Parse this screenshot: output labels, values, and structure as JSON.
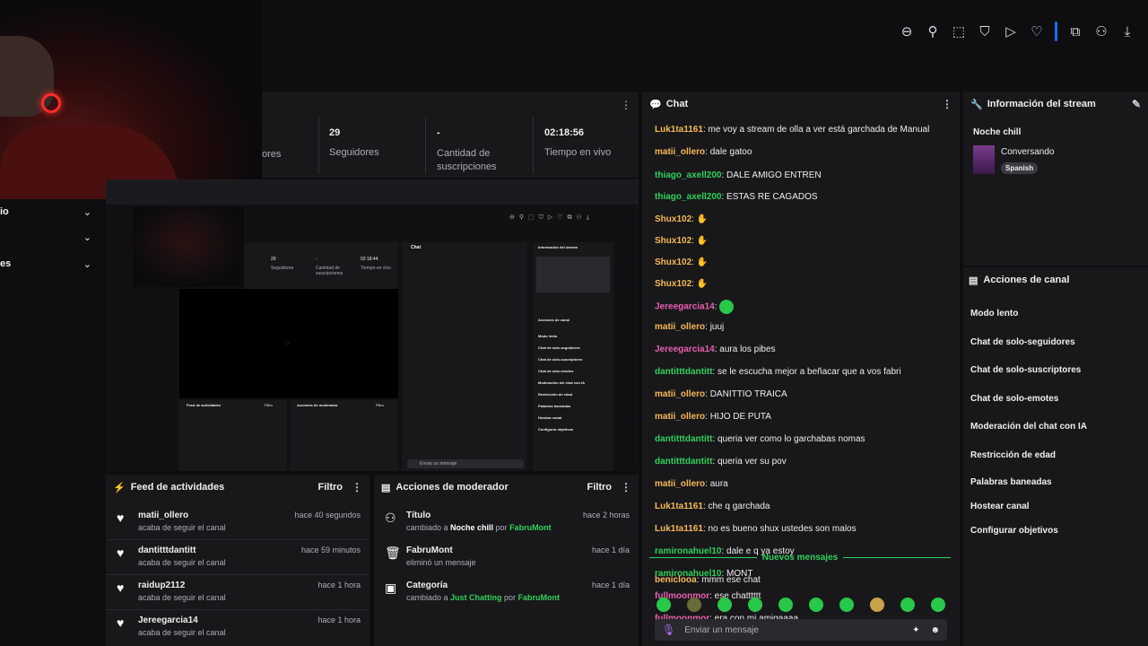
{
  "toolbar": {
    "icons": [
      "zoom-out-icon",
      "pin-icon",
      "crop-icon",
      "shield-icon",
      "send-icon",
      "heart-icon",
      "extension-icon",
      "profile-icon",
      "download-icon"
    ]
  },
  "stats": [
    {
      "value": "",
      "label": "ores"
    },
    {
      "value": "29",
      "label": "Seguidores"
    },
    {
      "value": "-",
      "label": "Cantidad de suscripciones"
    },
    {
      "value": "02:18:56",
      "label": "Tiempo en vivo"
    }
  ],
  "sidebar": {
    "items": [
      {
        "label": "io"
      },
      {
        "label": ""
      },
      {
        "label": "es"
      }
    ]
  },
  "chat": {
    "title": "Chat",
    "messages": [
      {
        "user": "Luk1ta1161",
        "color": "#f7b955",
        "text": "me voy a stream de olla a ver está garchada de Manual"
      },
      {
        "user": "matii_ollero",
        "color": "#f7b955",
        "text": "dale gatoo"
      },
      {
        "user": "thiago_axell200",
        "color": "#31d158",
        "text": "DALE AMIGO ENTREN"
      },
      {
        "user": "thiago_axell200",
        "color": "#31d158",
        "text": "ESTAS RE CAGADOS"
      },
      {
        "user": "Shux102",
        "color": "#f7b955",
        "text": ""
      },
      {
        "user": "Shux102",
        "color": "#f7b955",
        "text": ""
      },
      {
        "user": "Shux102",
        "color": "#f7b955",
        "text": ""
      },
      {
        "user": "Shux102",
        "color": "#f7b955",
        "text": ""
      },
      {
        "user": "Jereegarcia14",
        "color": "#e85fb1",
        "text": ""
      },
      {
        "user": "matii_ollero",
        "color": "#f7b955",
        "text": "juuj"
      },
      {
        "user": "Jereegarcia14",
        "color": "#e85fb1",
        "text": "aura los pibes"
      },
      {
        "user": "dantitttdantitt",
        "color": "#31d158",
        "text": "se le escucha mejor a beñacar que a vos fabri"
      },
      {
        "user": "matii_ollero",
        "color": "#f7b955",
        "text": "DANITTIO TRAICA"
      },
      {
        "user": "matii_ollero",
        "color": "#f7b955",
        "text": "HIJO DE PUTA"
      },
      {
        "user": "dantitttdantitt",
        "color": "#31d158",
        "text": "queria ver como lo garchabas nomas"
      },
      {
        "user": "dantitttdantitt",
        "color": "#31d158",
        "text": "queria ver su pov"
      },
      {
        "user": "matii_ollero",
        "color": "#f7b955",
        "text": "aura"
      },
      {
        "user": "Luk1ta1161",
        "color": "#f7b955",
        "text": "che q garchada"
      },
      {
        "user": "Luk1ta1161",
        "color": "#f7b955",
        "text": "no es bueno shux ustedes son malos"
      },
      {
        "user": "ramironahuel10",
        "color": "#31d158",
        "text": "dale e q ya estoy"
      },
      {
        "user": "ramironahuel10",
        "color": "#31d158",
        "text": "MONT"
      },
      {
        "user": "fullmoonmor",
        "color": "#e85fb1",
        "text": "ese chatttttt"
      },
      {
        "user": "fullmoonmor",
        "color": "#e85fb1",
        "text": "era con mi amigaaaa"
      }
    ],
    "new_messages_label": "Nuevos mensajes",
    "last_message": {
      "user": "beniclooa",
      "color": "#f7b955",
      "text": "mmm ese chat"
    },
    "input_placeholder": "Enviar un mensaje"
  },
  "stream_info": {
    "title": "Información del stream",
    "stream_title": "Noche chill",
    "category": "Conversando",
    "tag": "Spanish"
  },
  "channel_actions": {
    "title": "Acciones de canal",
    "items": [
      "Modo lento",
      "Chat de solo-seguidores",
      "Chat de solo-suscriptores",
      "Chat de solo-emotes",
      "Moderación del chat con IA",
      "Restricción de edad",
      "Palabras baneadas",
      "Hostear canal",
      "Configurar objetivos"
    ]
  },
  "activity_feed": {
    "title": "Feed de actividades",
    "filter_label": "Filtro",
    "items": [
      {
        "name": "matii_ollero",
        "sub": "acaba de seguir el canal",
        "time": "hace 40 segundos"
      },
      {
        "name": "dantitttdantitt",
        "sub": "acaba de seguir el canal",
        "time": "hace 59 minutos"
      },
      {
        "name": "raidup2112",
        "sub": "acaba de seguir el canal",
        "time": "hace 1 hora"
      },
      {
        "name": "Jereegarcia14",
        "sub": "acaba de seguir el canal",
        "time": "hace 1 hora"
      }
    ]
  },
  "mod_actions": {
    "title": "Acciones de moderador",
    "filter_label": "Filtro",
    "items": [
      {
        "name": "Título",
        "pre": "cambiado a ",
        "value": "Noche chill",
        "mid": " por ",
        "by": "FabruMont",
        "time": "hace 2 horas",
        "icon": "title-icon"
      },
      {
        "name": "FabruMont",
        "pre": "eliminó un mensaje",
        "value": "",
        "mid": "",
        "by": "",
        "time": "hace 1 día",
        "icon": "trash-icon"
      },
      {
        "name": "Categoría",
        "pre": "cambiado a ",
        "value": "Just Chatting",
        "mid": " por ",
        "by": "FabruMont",
        "time": "hace 1 día",
        "icon": "category-icon"
      }
    ]
  },
  "nested_preview": {
    "stats": [
      {
        "value": "29",
        "label": "Seguidores"
      },
      {
        "value": "-",
        "label": "Cantidad de suscripciones"
      },
      {
        "value": "02:18:44",
        "label": "Tiempo en vivo"
      }
    ],
    "chat_title": "Chat",
    "info_title": "Información del stream",
    "actions_title": "Acciones de canal",
    "actions": [
      "Modo lento",
      "Chat de solo-seguidores",
      "Chat de solo-suscriptores",
      "Chat de solo-emotes",
      "Moderación del chat con IA",
      "Restricción de edad",
      "Palabras baneadas",
      "Hostear canal",
      "Configurar objetivos"
    ],
    "feed_title": "Feed de actividades",
    "mod_title": "Acciones de moderador",
    "filter_label": "Filtro",
    "input_placeholder": "Enviar un mensaje"
  },
  "colors": {
    "accent": "#31d158",
    "bg": "#0e0e10",
    "panel": "#18181b",
    "highlight": "#a970ff"
  }
}
